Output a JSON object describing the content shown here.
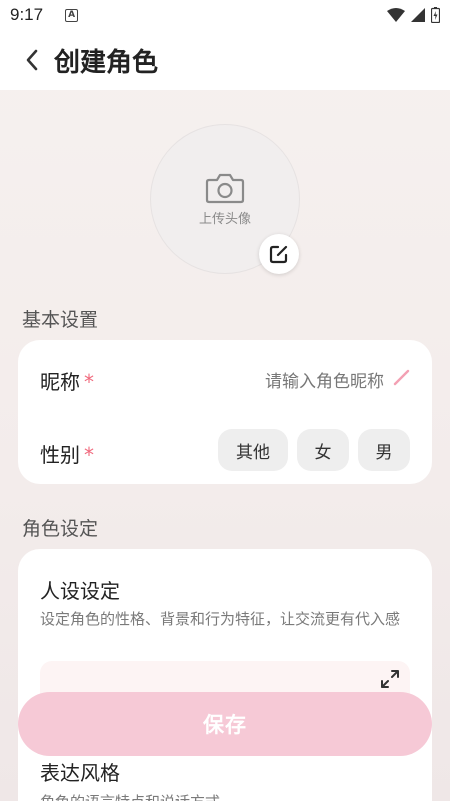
{
  "status_bar": {
    "time": "9:17",
    "notification_icon": "A"
  },
  "header": {
    "title": "创建角色"
  },
  "avatar": {
    "upload_label": "上传头像"
  },
  "basic_settings": {
    "section_title": "基本设置",
    "nickname_label": "昵称",
    "nickname_placeholder": "请输入角色昵称",
    "gender_label": "性别",
    "required_mark": "*",
    "gender_options": [
      "其他",
      "女",
      "男"
    ]
  },
  "role_settings": {
    "section_title": "角色设定",
    "persona_title": "人设设定",
    "persona_desc": "设定角色的性格、背景和行为特征，让交流更有代入感",
    "style_title": "表达风格",
    "style_desc": "角色的语言特点和说话方式"
  },
  "save_label": "保存",
  "colors": {
    "accent": "#f06a7e",
    "save_bg": "#f6c9d6"
  }
}
